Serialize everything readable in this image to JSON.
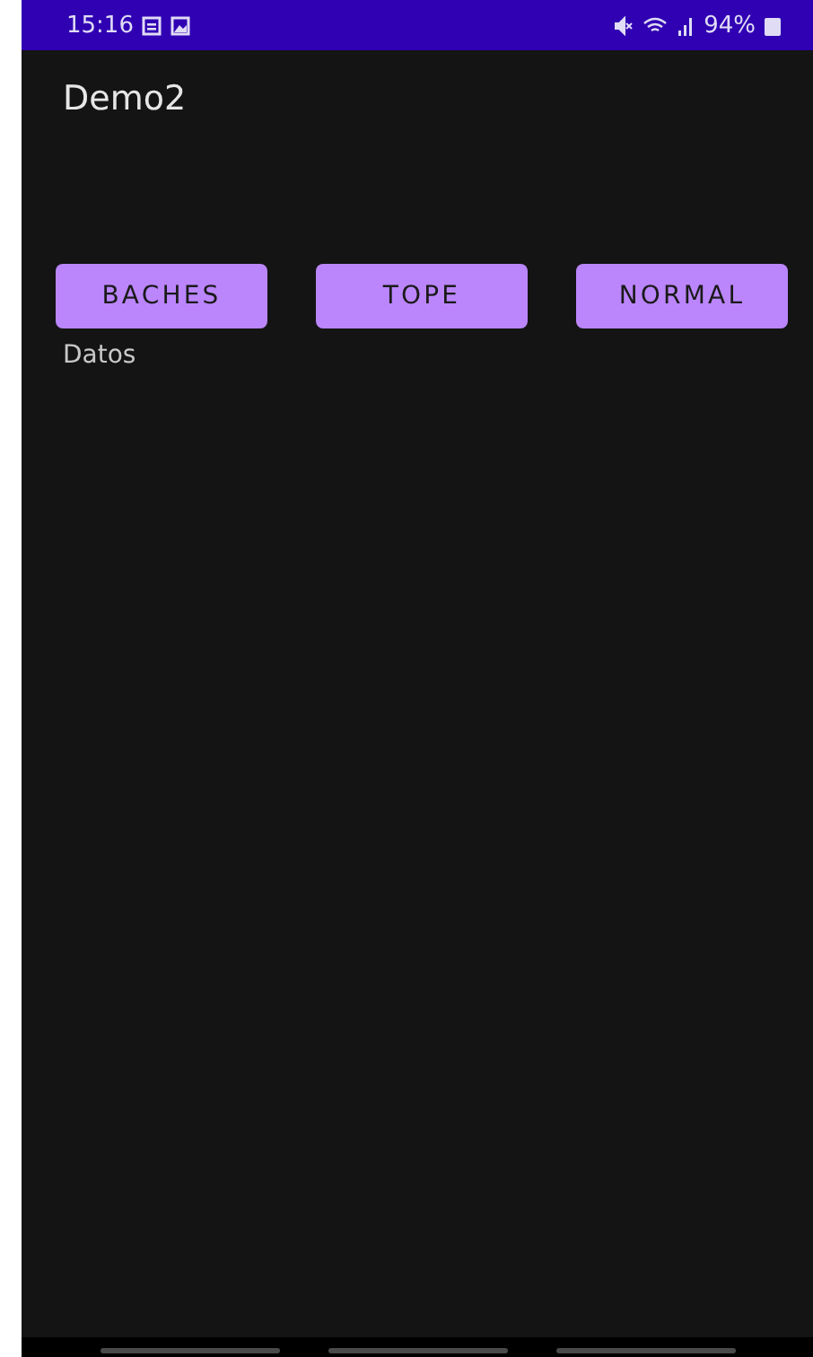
{
  "status_bar": {
    "time": "15:16",
    "battery": "94%"
  },
  "app_bar": {
    "title": "Demo2"
  },
  "buttons": [
    {
      "label": "BACHES"
    },
    {
      "label": "TOPE"
    },
    {
      "label": "NORMAL"
    }
  ],
  "output_label": "Datos"
}
